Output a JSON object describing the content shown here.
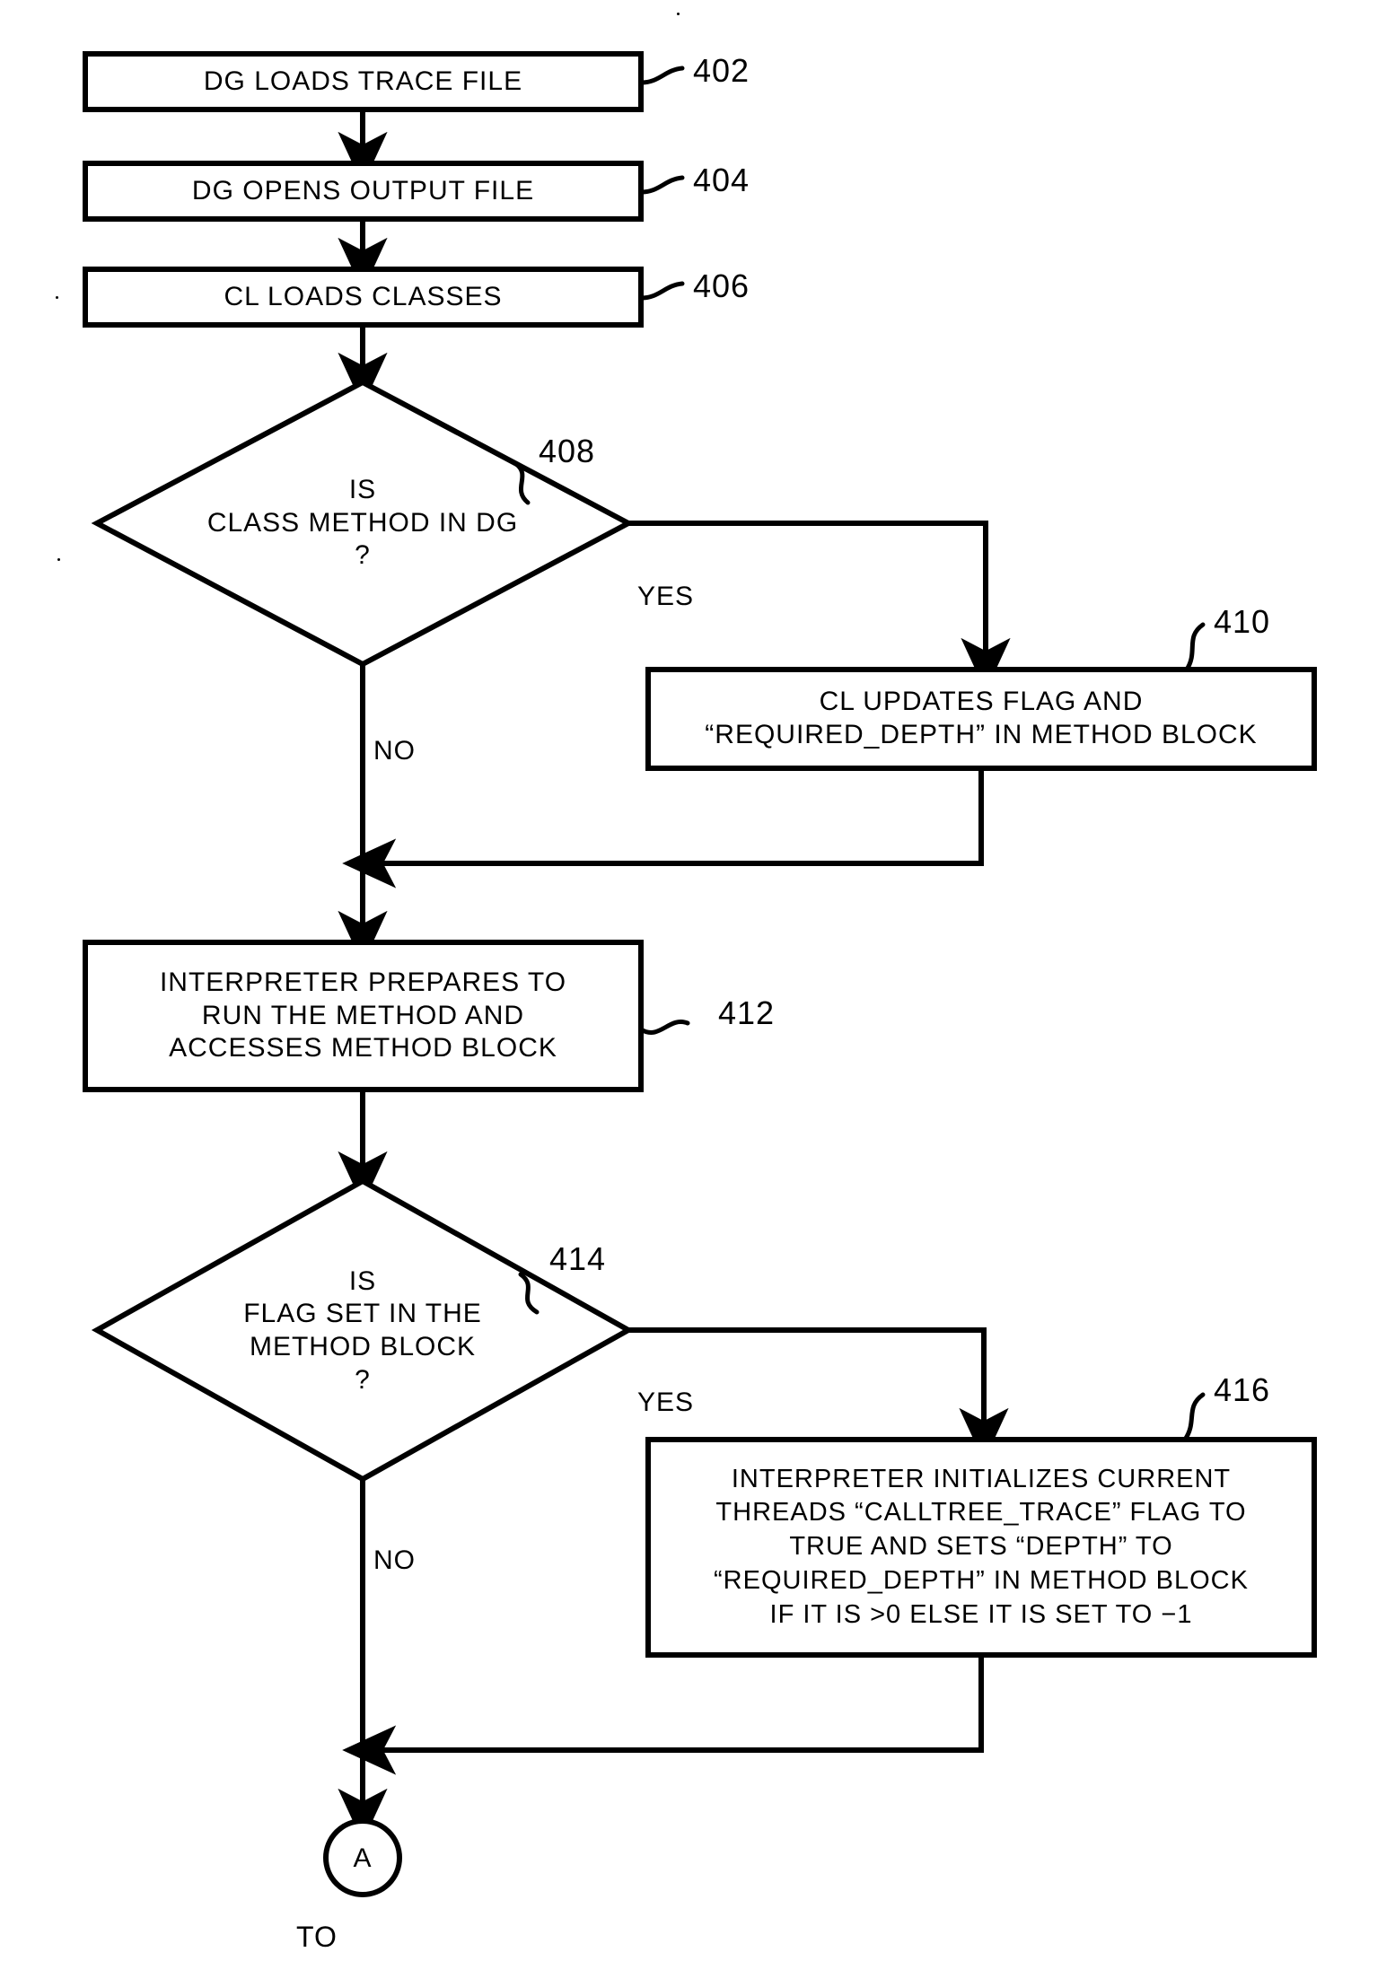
{
  "figure": {
    "type": "flowchart",
    "title": "",
    "nodes": [
      {
        "id": "402",
        "shape": "process",
        "ref": "402",
        "lines": [
          "DG LOADS TRACE FILE"
        ]
      },
      {
        "id": "404",
        "shape": "process",
        "ref": "404",
        "lines": [
          "DG OPENS OUTPUT FILE"
        ]
      },
      {
        "id": "406",
        "shape": "process",
        "ref": "406",
        "lines": [
          "CL LOADS CLASSES"
        ]
      },
      {
        "id": "408",
        "shape": "decision",
        "ref": "408",
        "lines": [
          "IS",
          "CLASS METHOD IN DG",
          "?"
        ]
      },
      {
        "id": "410",
        "shape": "process",
        "ref": "410",
        "lines": [
          "CL UPDATES FLAG AND",
          "“REQUIRED_DEPTH” IN METHOD BLOCK"
        ]
      },
      {
        "id": "412",
        "shape": "process",
        "ref": "412",
        "lines": [
          "INTERPRETER PREPARES TO",
          "RUN THE METHOD AND",
          "ACCESSES METHOD BLOCK"
        ]
      },
      {
        "id": "414",
        "shape": "decision",
        "ref": "414",
        "lines": [
          "IS",
          "FLAG SET IN THE",
          "METHOD BLOCK",
          "?"
        ]
      },
      {
        "id": "416",
        "shape": "process",
        "ref": "416",
        "lines": [
          "INTERPRETER INITIALIZES CURRENT",
          "THREADS “CALLTREE_TRACE” FLAG TO",
          "TRUE AND SETS “DEPTH” TO",
          "“REQUIRED_DEPTH” IN METHOD BLOCK",
          "IF IT IS >0 ELSE IT IS SET TO −1"
        ]
      },
      {
        "id": "connector-a",
        "shape": "connector",
        "ref": "",
        "lines": [
          "A"
        ]
      }
    ],
    "edge_labels": {
      "yes_408": "YES",
      "no_408": "NO",
      "yes_414": "YES",
      "no_414": "NO"
    },
    "footer": {
      "to_label": "TO"
    },
    "colors": {
      "stroke": "#000000",
      "fill": "#ffffff",
      "text": "#000000"
    }
  }
}
